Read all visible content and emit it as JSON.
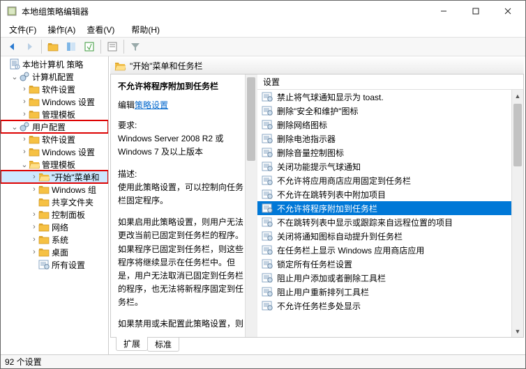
{
  "window": {
    "title": "本地组策略编辑器"
  },
  "menu": {
    "file": "文件(F)",
    "action": "操作(A)",
    "view": "查看(V)",
    "help": "帮助(H)"
  },
  "tree": {
    "root": "本地计算机 策略",
    "computer": {
      "label": "计算机配置",
      "soft": "软件设置",
      "win": "Windows 设置",
      "admin": "管理模板"
    },
    "user": {
      "label": "用户配置",
      "soft": "软件设置",
      "win": "Windows 设置",
      "admin": {
        "label": "管理模板",
        "start": "\"开始\"菜单和",
        "wincomp": "Windows 组",
        "shared": "共享文件夹",
        "cpanel": "控制面板",
        "network": "网络",
        "system": "系统",
        "desktop": "桌面",
        "all": "所有设置"
      }
    }
  },
  "breadcrumb": {
    "title": "\"开始\"菜单和任务栏"
  },
  "detail": {
    "title": "不允许将程序附加到任务栏",
    "editPre": "编辑",
    "editLink": "策略设置",
    "reqLabel": "要求:",
    "reqText": "Windows Server 2008 R2 或 Windows 7 及以上版本",
    "descLabel": "描述:",
    "descText1": "使用此策略设置，可以控制向任务栏固定程序。",
    "descText2": "如果启用此策略设置，则用户无法更改当前已固定到任务栏的程序。如果程序已固定到任务栏，则这些程序将继续显示在任务栏中。但是，用户无法取消已固定到任务栏的程序，也无法将新程序固定到任务栏。",
    "descText3": "如果禁用或未配置此策略设置，则"
  },
  "list": {
    "header": "设置",
    "items": [
      "禁止将气球通知显示为 toast.",
      "删除\"安全和维护\"图标",
      "删除网络图标",
      "删除电池指示器",
      "删除音量控制图标",
      "关闭功能提示气球通知",
      "不允许将应用商店应用固定到任务栏",
      "不允许在跳转列表中附加项目",
      "不允许将程序附加到任务栏",
      "不在跳转列表中显示或跟踪来自远程位置的项目",
      "关闭将通知图标自动提升到任务栏",
      "在任务栏上显示 Windows 应用商店应用",
      "锁定所有任务栏设置",
      "阻止用户添加或者删除工具栏",
      "阻止用户重新排列工具栏",
      "不允许任务栏多处显示"
    ],
    "selectedIndex": 8
  },
  "tabs": {
    "extended": "扩展",
    "standard": "标准"
  },
  "status": {
    "text": "92 个设置"
  }
}
